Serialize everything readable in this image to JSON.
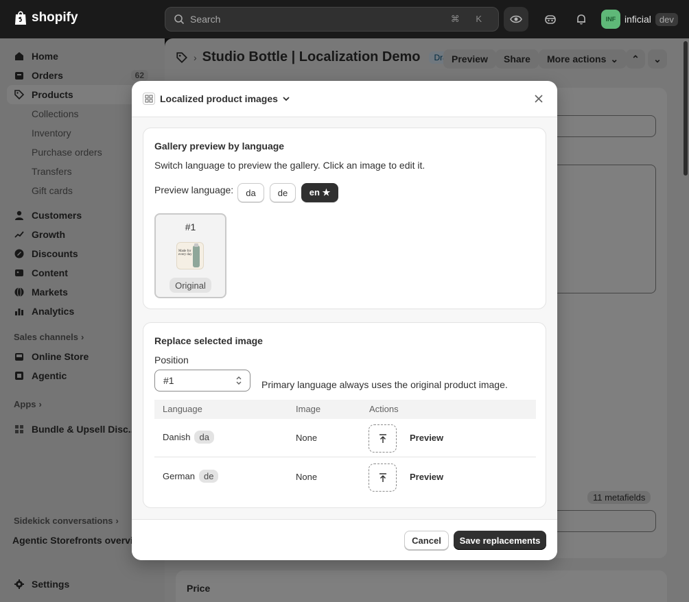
{
  "topbar": {
    "brand": "shopify",
    "search_placeholder": "Search",
    "search_shortcut": "⌘ K",
    "store_avatar": "INF",
    "store_name": "inficial",
    "env_badge": "dev"
  },
  "sidebar": {
    "home": "Home",
    "orders": "Orders",
    "orders_count": "62",
    "products": "Products",
    "collections": "Collections",
    "inventory": "Inventory",
    "purchase_orders": "Purchase orders",
    "transfers": "Transfers",
    "gift_cards": "Gift cards",
    "customers": "Customers",
    "growth": "Growth",
    "discounts": "Discounts",
    "content": "Content",
    "markets": "Markets",
    "analytics": "Analytics",
    "sales_channels": "Sales channels",
    "online_store": "Online Store",
    "agentic": "Agentic",
    "apps": "Apps",
    "bundle_app": "Bundle & Upsell Disc...",
    "sidekick": "Sidekick conversations",
    "agentic_overview": "Agentic Storefronts overvie",
    "settings": "Settings"
  },
  "page": {
    "title": "Studio Bottle | Localization Demo",
    "status": "Draft",
    "preview": "Preview",
    "share": "Share",
    "more_actions": "More actions",
    "metafields": "11 metafields",
    "price": "Price"
  },
  "modal": {
    "title": "Localized product images",
    "gallery": {
      "title": "Gallery preview by language",
      "description": "Switch language to preview the gallery. Click an image to edit it.",
      "preview_language_label": "Preview language:",
      "languages": [
        "da",
        "de",
        "en ★"
      ],
      "thumb_number": "#1",
      "thumb_label": "Original",
      "thumb_image_text_1": "Made for",
      "thumb_image_text_2": "every day"
    },
    "replace": {
      "title": "Replace selected image",
      "position_label": "Position",
      "position_value": "#1",
      "note": "Primary language always uses the original product image.",
      "columns": [
        "Language",
        "Image",
        "Actions"
      ],
      "rows": [
        {
          "language": "Danish",
          "code": "da",
          "image": "None",
          "action": "Preview"
        },
        {
          "language": "German",
          "code": "de",
          "image": "None",
          "action": "Preview"
        }
      ]
    },
    "cancel": "Cancel",
    "save": "Save replacements"
  }
}
